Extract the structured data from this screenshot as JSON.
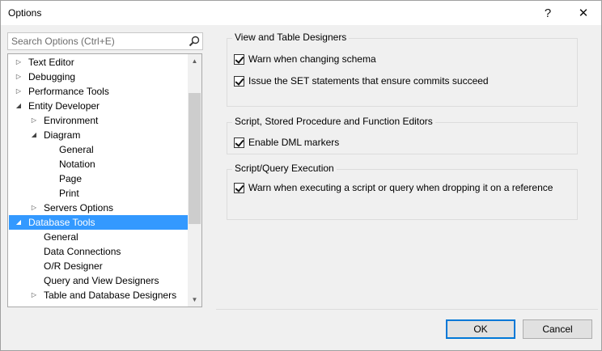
{
  "window": {
    "title": "Options",
    "help_glyph": "?",
    "close_glyph": "✕"
  },
  "search": {
    "placeholder": "Search Options (Ctrl+E)",
    "icon": "search-icon"
  },
  "tree": {
    "items": [
      {
        "label": "Text Editor",
        "level": 0,
        "expander": "collapsed"
      },
      {
        "label": "Debugging",
        "level": 0,
        "expander": "collapsed"
      },
      {
        "label": "Performance Tools",
        "level": 0,
        "expander": "collapsed"
      },
      {
        "label": "Entity Developer",
        "level": 0,
        "expander": "expanded"
      },
      {
        "label": "Environment",
        "level": 1,
        "expander": "collapsed"
      },
      {
        "label": "Diagram",
        "level": 1,
        "expander": "expanded"
      },
      {
        "label": "General",
        "level": 2,
        "expander": "none"
      },
      {
        "label": "Notation",
        "level": 2,
        "expander": "none"
      },
      {
        "label": "Page",
        "level": 2,
        "expander": "none"
      },
      {
        "label": "Print",
        "level": 2,
        "expander": "none"
      },
      {
        "label": "Servers Options",
        "level": 1,
        "expander": "collapsed"
      },
      {
        "label": "Database Tools",
        "level": 0,
        "expander": "expanded",
        "selected": true
      },
      {
        "label": "General",
        "level": 1,
        "expander": "none"
      },
      {
        "label": "Data Connections",
        "level": 1,
        "expander": "none"
      },
      {
        "label": "O/R Designer",
        "level": 1,
        "expander": "none"
      },
      {
        "label": "Query and View Designers",
        "level": 1,
        "expander": "none"
      },
      {
        "label": "Table and Database Designers",
        "level": 1,
        "expander": "collapsed"
      }
    ],
    "selected_color": "#3399ff"
  },
  "groups": {
    "view_table": {
      "title": "View and Table Designers",
      "options": [
        {
          "label": "Warn when changing schema",
          "checked": true
        },
        {
          "label": "Issue the SET statements that ensure commits succeed",
          "checked": true
        }
      ]
    },
    "script_editors": {
      "title": "Script, Stored Procedure and Function Editors",
      "options": [
        {
          "label": "Enable DML markers",
          "checked": true
        }
      ]
    },
    "query_execution": {
      "title": "Script/Query Execution",
      "options": [
        {
          "label": "Warn when executing a script or query when dropping it on a reference",
          "checked": true
        }
      ]
    }
  },
  "buttons": {
    "ok": "OK",
    "cancel": "Cancel"
  }
}
